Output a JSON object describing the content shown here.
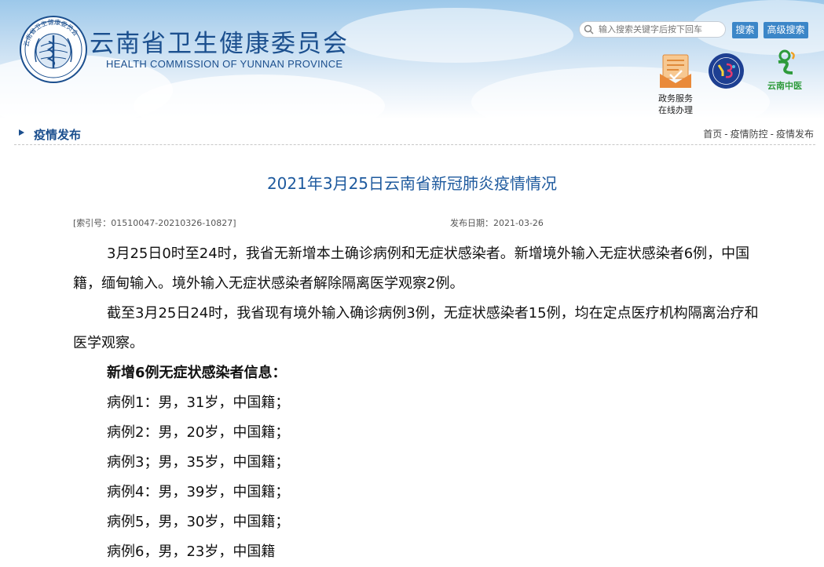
{
  "header": {
    "title": "云南省卫生健康委员会",
    "subtitle": "HEALTH COMMISSION OF YUNNAN PROVINCE",
    "emblem_text": "云南省卫生健康委员会",
    "search": {
      "placeholder": "输入搜索关键字后按下回车",
      "value": ""
    },
    "search_button": "搜索",
    "advanced_search_button": "高级搜索",
    "service_label_line1": "政务服务",
    "service_label_line2": "在线办理",
    "yunnan_tcm_label": "云南中医",
    "colors": {
      "brand": "#1b4f8e",
      "button": "#3b86c8",
      "tcm_green": "#2e9b3c"
    }
  },
  "section": {
    "title": "疫情发布",
    "breadcrumbs": [
      "首页",
      "疫情防控",
      "疫情发布"
    ],
    "separator": "-"
  },
  "article": {
    "title": "2021年3月25日云南省新冠肺炎疫情情况",
    "index_no": "[索引号：01510047-20210326-10827]",
    "publish_date": "发布日期：2021-03-26",
    "paragraphs": [
      "3月25日0时至24时，我省无新增本土确诊病例和无症状感染者。新增境外输入无症状感染者6例，中国籍，缅甸输入。境外输入无症状感染者解除隔离医学观察2例。",
      "截至3月25日24时，我省现有境外输入确诊病例3例，无症状感染者15例，均在定点医疗机构隔离治疗和医学观察。"
    ],
    "subheading": "新增6例无症状感染者信息：",
    "cases": [
      "病例1：男，31岁，中国籍；",
      "病例2：男，20岁，中国籍；",
      "病例3；男，35岁，中国籍；",
      "病例4：男，39岁，中国籍；",
      "病例5，男，30岁，中国籍；",
      "病例6，男，23岁，中国籍"
    ]
  }
}
